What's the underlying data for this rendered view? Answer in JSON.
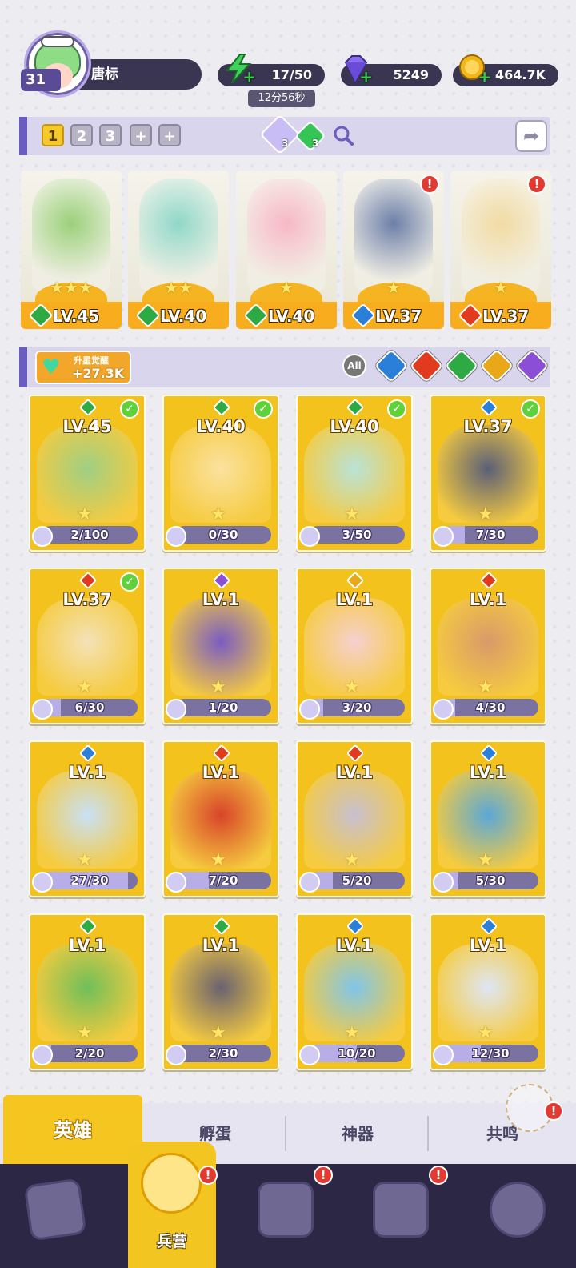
{
  "player": {
    "level": "31",
    "name": "唐标"
  },
  "resources": {
    "energy": {
      "value": "17/50",
      "timer": "12分56秒",
      "color": "#3fd25a"
    },
    "gems": {
      "value": "5249",
      "color": "#8b6cf0"
    },
    "gold": {
      "value": "464.7K",
      "color": "#f2b51e"
    }
  },
  "team_tabs": [
    "1",
    "2",
    "3",
    "+",
    "+"
  ],
  "team_gems": [
    {
      "count": "3",
      "color": "#c9bdf5"
    },
    {
      "count": "3",
      "color": "#36c456"
    }
  ],
  "element_colors": {
    "nature": "#2eaa44",
    "water": "#2a7fd8",
    "fire": "#e23a1e",
    "light": "#e8a817",
    "dark": "#8a4fd6"
  },
  "team": [
    {
      "level": "LV.45",
      "element": "nature",
      "stars": "★★★",
      "art_color": "#9bd07a",
      "alert": ""
    },
    {
      "level": "LV.40",
      "element": "nature",
      "stars": "★★",
      "art_color": "#8fd8c8",
      "alert": ""
    },
    {
      "level": "LV.40",
      "element": "nature",
      "stars": "★",
      "art_color": "#f7b8c6",
      "alert": ""
    },
    {
      "level": "LV.37",
      "element": "water",
      "stars": "★",
      "art_color": "#6d7fa8",
      "alert": "!"
    },
    {
      "level": "LV.37",
      "element": "fire",
      "stars": "★",
      "art_color": "#f1dba3",
      "alert": "!"
    }
  ],
  "awaken": {
    "title": "升星觉醒",
    "value": "+27.3K"
  },
  "filters": {
    "all_label": "All",
    "elements": [
      "water",
      "fire",
      "nature",
      "light",
      "dark"
    ]
  },
  "heroes": [
    {
      "level": "LV.45",
      "element": "nature",
      "progress": "2/100",
      "fraction": 0.02,
      "checked": true,
      "art_color": "#9fcf84"
    },
    {
      "level": "LV.40",
      "element": "nature",
      "progress": "0/30",
      "fraction": 0.0,
      "checked": true,
      "art_color": "#fbe2a0"
    },
    {
      "level": "LV.40",
      "element": "nature",
      "progress": "3/50",
      "fraction": 0.06,
      "checked": true,
      "art_color": "#b9e3d8"
    },
    {
      "level": "LV.37",
      "element": "water",
      "progress": "7/30",
      "fraction": 0.23,
      "checked": true,
      "art_color": "#5b5f78"
    },
    {
      "level": "LV.37",
      "element": "fire",
      "progress": "6/30",
      "fraction": 0.2,
      "checked": true,
      "art_color": "#f3e2b8"
    },
    {
      "level": "LV.1",
      "element": "dark",
      "progress": "1/20",
      "fraction": 0.05,
      "checked": false,
      "art_color": "#7a5cc4"
    },
    {
      "level": "LV.1",
      "element": "light",
      "progress": "3/20",
      "fraction": 0.15,
      "checked": false,
      "art_color": "#f6d0d0"
    },
    {
      "level": "LV.1",
      "element": "fire",
      "progress": "4/30",
      "fraction": 0.13,
      "checked": false,
      "art_color": "#d99a6a"
    },
    {
      "level": "LV.1",
      "element": "water",
      "progress": "27/30",
      "fraction": 0.9,
      "checked": false,
      "art_color": "#c9e0f5"
    },
    {
      "level": "LV.1",
      "element": "fire",
      "progress": "7/20",
      "fraction": 0.35,
      "checked": false,
      "art_color": "#d8442a"
    },
    {
      "level": "LV.1",
      "element": "fire",
      "progress": "5/20",
      "fraction": 0.25,
      "checked": false,
      "art_color": "#c8c0d0"
    },
    {
      "level": "LV.1",
      "element": "water",
      "progress": "5/30",
      "fraction": 0.17,
      "checked": false,
      "art_color": "#5aa8d8"
    },
    {
      "level": "LV.1",
      "element": "nature",
      "progress": "2/20",
      "fraction": 0.1,
      "checked": false,
      "art_color": "#6fbf5a"
    },
    {
      "level": "LV.1",
      "element": "nature",
      "progress": "2/30",
      "fraction": 0.07,
      "checked": false,
      "art_color": "#6a6270"
    },
    {
      "level": "LV.1",
      "element": "water",
      "progress": "10/20",
      "fraction": 0.5,
      "checked": false,
      "art_color": "#7fc6ea"
    },
    {
      "level": "LV.1",
      "element": "water",
      "progress": "12/30",
      "fraction": 0.4,
      "checked": false,
      "art_color": "#dfe6f5"
    }
  ],
  "subtabs": {
    "heroes": "英雄",
    "hatch": "孵蛋",
    "artifact": "神器",
    "resonance": "共鸣",
    "resonance_alert": "!"
  },
  "bottom_nav": {
    "active_label": "兵营",
    "alerts": [
      "!",
      "!",
      "!"
    ]
  }
}
